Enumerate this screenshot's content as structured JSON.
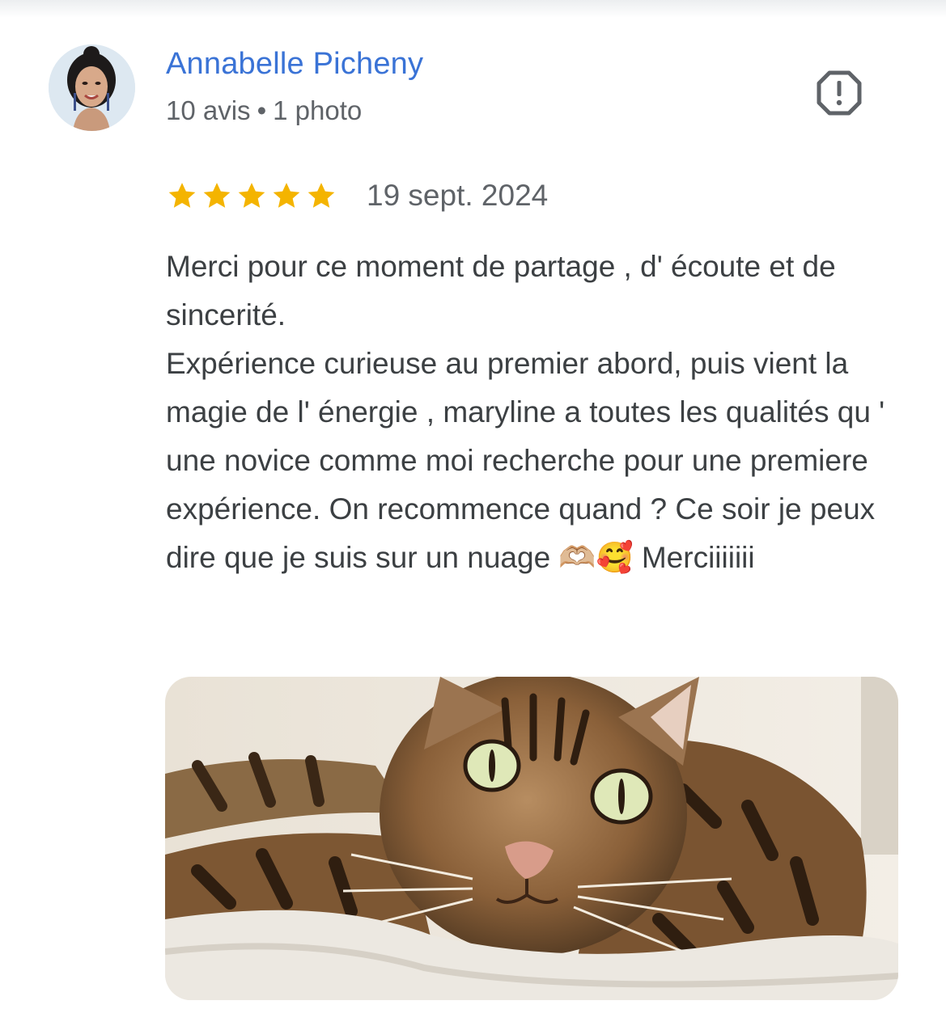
{
  "review": {
    "author": {
      "name": "Annabelle Picheny",
      "reviews_count": "10 avis",
      "separator": "•",
      "photos_count": "1 photo"
    },
    "rating": 5,
    "rating_max": 5,
    "date": "19 sept. 2024",
    "text": "Merci pour ce moment de partage , d' écoute et de sincerité.\nExpérience curieuse au premier abord, puis vient la magie de l' énergie , maryline a toutes les qualités qu ' une novice comme moi recherche pour une premiere expérience. On recommence quand ? Ce soir je peux dire que je suis sur un nuage 🫶🏼🥰 Merciiiiiii",
    "photo_icon": "bengal-cat-photo"
  },
  "colors": {
    "author_name": "#3a73d6",
    "star": "#f4b400",
    "meta_text": "#5f6368",
    "body_text": "#3c4043"
  }
}
